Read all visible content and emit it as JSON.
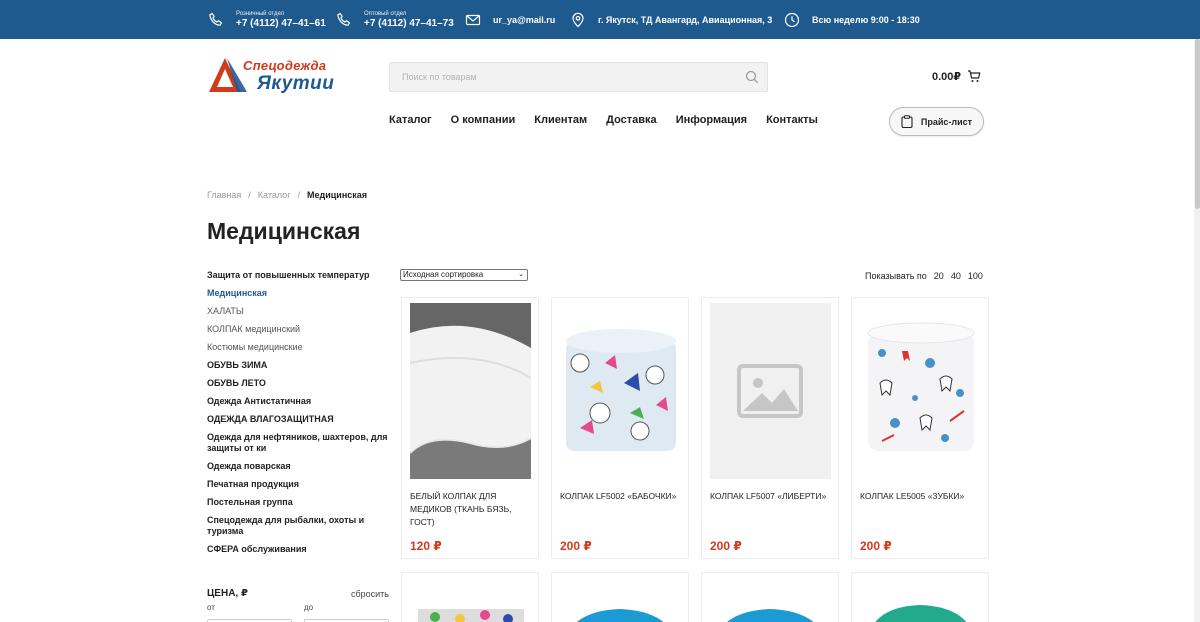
{
  "topbar": {
    "retail_label": "Розничный отдел",
    "retail_phone": "+7 (4112) 47–41–61",
    "wholesale_label": "Оптовый отдел",
    "wholesale_phone": "+7 (4112) 47–41–73",
    "email": "ur_ya@mail.ru",
    "address": "г. Якутск, ТД Авангард, Авиационная, 3",
    "hours": "Всю неделю 9:00 - 18:30"
  },
  "logo": {
    "line1": "Спецодежда",
    "line2": "Якутии"
  },
  "search": {
    "placeholder": "Поиск по товарам"
  },
  "cart": {
    "total": "0.00₽"
  },
  "nav": [
    "Каталог",
    "О компании",
    "Клиентам",
    "Доставка",
    "Информация",
    "Контакты"
  ],
  "price_list_button": "Прайс-лист",
  "breadcrumb": {
    "home": "Главная",
    "catalog": "Каталог",
    "current": "Медицинская",
    "separator": "/"
  },
  "page_title": "Медицинская",
  "categories": [
    {
      "label": "Защита от повышенных температур",
      "style": "bold"
    },
    {
      "label": "Медицинская",
      "style": "active"
    },
    {
      "label": "ХАЛАТЫ",
      "style": "light"
    },
    {
      "label": "КОЛПАК медицинский",
      "style": "light"
    },
    {
      "label": "Костюмы медицинские",
      "style": "light"
    },
    {
      "label": "ОБУВЬ ЗИМА",
      "style": "bold"
    },
    {
      "label": "ОБУВЬ ЛЕТО",
      "style": "bold"
    },
    {
      "label": "Одежда Антистатичная",
      "style": "bold"
    },
    {
      "label": "ОДЕЖДА ВЛАГОЗАЩИТНАЯ",
      "style": "bold"
    },
    {
      "label": "Одежда для нефтяников, шахтеров, для защиты от ки",
      "style": "bold"
    },
    {
      "label": "Одежда поварская",
      "style": "bold"
    },
    {
      "label": "Печатная продукция",
      "style": "bold"
    },
    {
      "label": "Постельная группа",
      "style": "bold"
    },
    {
      "label": "Спецодежда для рыбалки, охоты и туризма",
      "style": "bold"
    },
    {
      "label": "СФЕРА обслуживания",
      "style": "bold"
    }
  ],
  "price_filter": {
    "title": "ЦЕНА, ₽",
    "reset": "сбросить",
    "from": "от",
    "to": "до"
  },
  "sort": {
    "selected": "Исходная сортировка"
  },
  "show_per_page": {
    "label": "Показывать по",
    "options": [
      "20",
      "40",
      "100"
    ]
  },
  "products": [
    {
      "title": "БЕЛЫЙ КОЛПАК ДЛЯ МЕДИКОВ (ТКАНЬ БЯЗЬ, ГОСТ)",
      "price": "120 ₽",
      "image": "white-cap"
    },
    {
      "title": "КОЛПАК LF5002 «БАБОЧКИ»",
      "price": "200 ₽",
      "image": "butterfly-cap"
    },
    {
      "title": "КОЛПАК LF5007 «ЛИБЕРТИ»",
      "price": "200 ₽",
      "image": "placeholder"
    },
    {
      "title": "КОЛПАК LE5005 «ЗУБКИ»",
      "price": "200 ₽",
      "image": "teeth-cap"
    }
  ],
  "colors": {
    "brand_blue": "#1f5a8f",
    "brand_red": "#d03a1d",
    "price_red": "#d03a1d"
  }
}
